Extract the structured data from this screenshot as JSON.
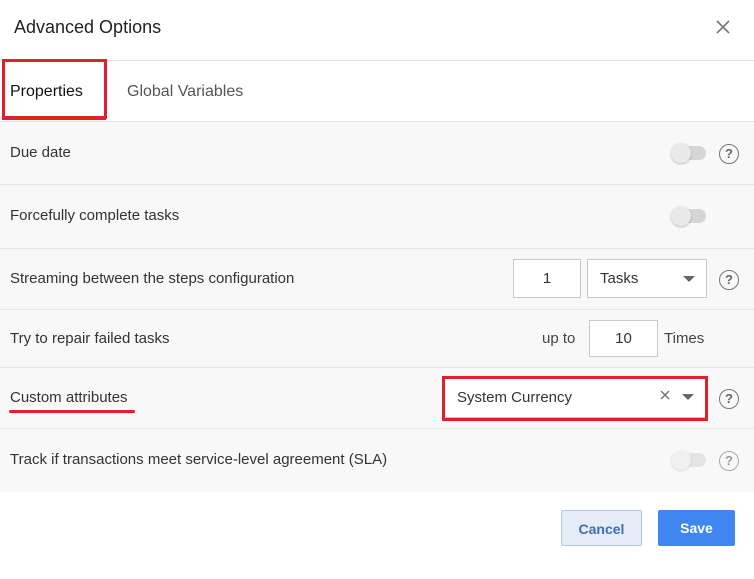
{
  "dialog": {
    "title": "Advanced Options"
  },
  "tabs": [
    {
      "label": "Properties",
      "active": true
    },
    {
      "label": "Global Variables",
      "active": false
    }
  ],
  "rows": {
    "due_date": {
      "label": "Due date"
    },
    "force_complete": {
      "label": "Forcefully complete tasks"
    },
    "streaming": {
      "label": "Streaming between the steps configuration",
      "value": "1",
      "unit": "Tasks"
    },
    "repair": {
      "label": "Try to repair failed tasks",
      "prefix": "up to",
      "value": "10",
      "suffix": "Times"
    },
    "custom_attributes": {
      "label": "Custom attributes",
      "value": "System Currency"
    },
    "sla": {
      "label": "Track if transactions meet service-level agreement (SLA)"
    }
  },
  "help_glyph": "?",
  "footer": {
    "cancel_label": "Cancel",
    "save_label": "Save"
  },
  "colors": {
    "accent": "#3f86f0",
    "highlight": "#e0212a",
    "tab_underline": "#3b5bb5"
  }
}
